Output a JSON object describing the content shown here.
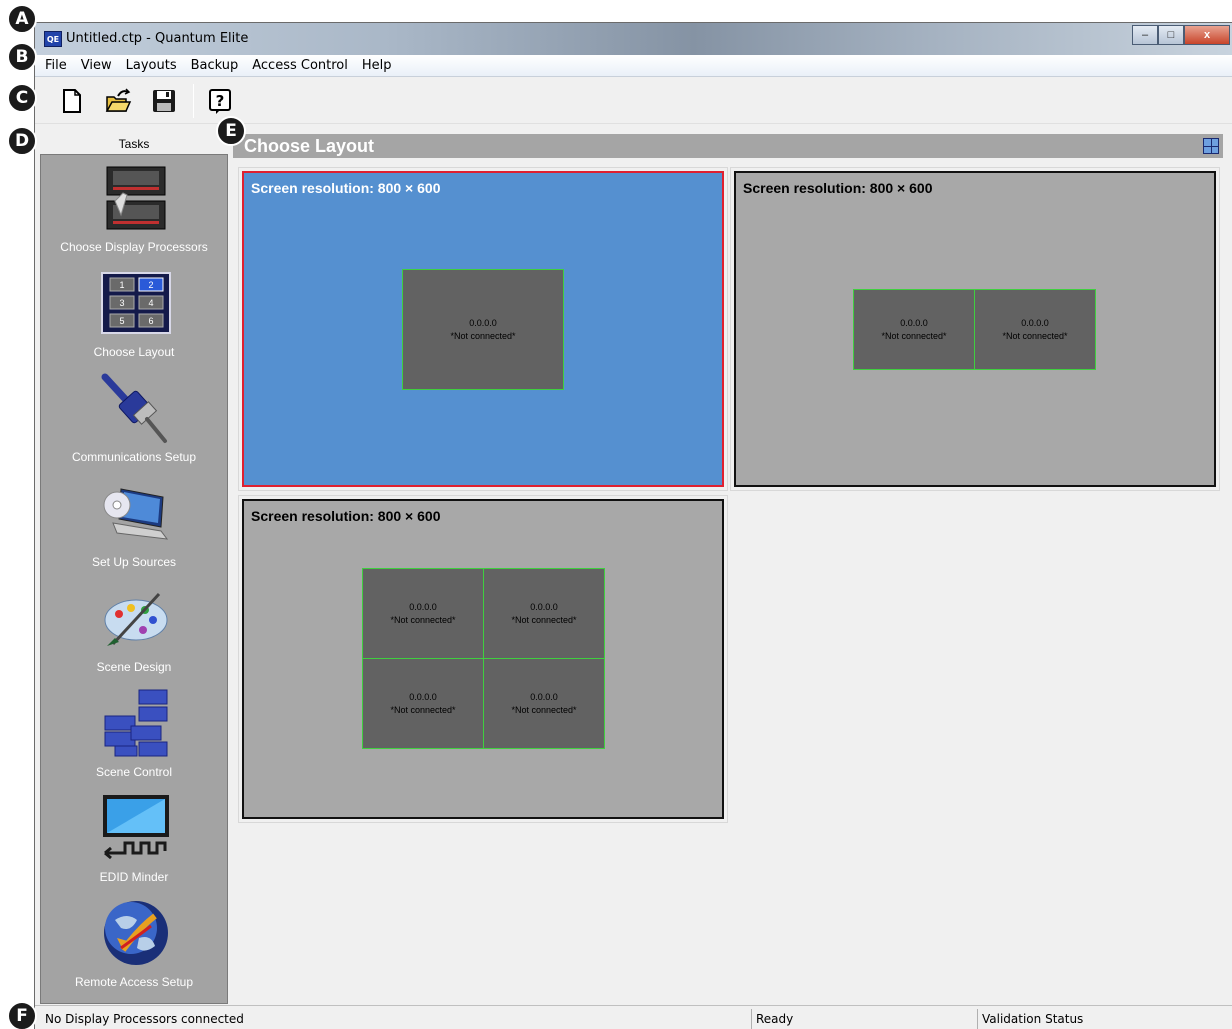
{
  "markers": [
    "A",
    "B",
    "C",
    "D",
    "E",
    "F"
  ],
  "window": {
    "app_icon_text": "QE",
    "title": "Untitled.ctp - Quantum Elite",
    "controls": {
      "minimize": "–",
      "maximize": "□",
      "close": "x"
    }
  },
  "menu": [
    "File",
    "View",
    "Layouts",
    "Backup",
    "Access Control",
    "Help"
  ],
  "toolbar": {
    "buttons": [
      {
        "name": "new",
        "icon": "new-document-icon"
      },
      {
        "name": "open",
        "icon": "open-folder-icon"
      },
      {
        "name": "save",
        "icon": "save-disk-icon"
      },
      {
        "name": "help",
        "icon": "help-question-icon"
      }
    ]
  },
  "tasks": {
    "header": "Tasks",
    "items": [
      {
        "label": "Choose Display Processors",
        "icon": "display-processors-icon"
      },
      {
        "label": "Choose Layout",
        "icon": "layout-grid-icon"
      },
      {
        "label": "Communications Setup",
        "icon": "cable-connector-icon"
      },
      {
        "label": "Set Up Sources",
        "icon": "laptop-disc-icon"
      },
      {
        "label": "Scene Design",
        "icon": "paint-palette-icon"
      },
      {
        "label": "Scene Control",
        "icon": "scene-blocks-icon"
      },
      {
        "label": "EDID Minder",
        "icon": "edid-monitor-icon"
      },
      {
        "label": "Remote Access Setup",
        "icon": "globe-arrow-icon"
      }
    ],
    "layout_icon_numbers": [
      "1",
      "2",
      "3",
      "4",
      "5",
      "6"
    ]
  },
  "main": {
    "title": "Choose Layout",
    "layouts": [
      {
        "resolution": "Screen resolution: 800 × 600",
        "selected": true,
        "screens": [
          {
            "ip": "0.0.0.0",
            "status": "*Not connected*"
          }
        ]
      },
      {
        "resolution": "Screen resolution: 800 × 600",
        "selected": false,
        "screens": [
          {
            "ip": "0.0.0.0",
            "status": "*Not connected*"
          },
          {
            "ip": "0.0.0.0",
            "status": "*Not connected*"
          }
        ]
      },
      {
        "resolution": "Screen resolution: 800 × 600",
        "selected": false,
        "screens": [
          {
            "ip": "0.0.0.0",
            "status": "*Not connected*"
          },
          {
            "ip": "0.0.0.0",
            "status": "*Not connected*"
          },
          {
            "ip": "0.0.0.0",
            "status": "*Not connected*"
          },
          {
            "ip": "0.0.0.0",
            "status": "*Not connected*"
          }
        ]
      }
    ]
  },
  "status": {
    "left": "No Display Processors connected",
    "middle": "Ready",
    "right": "Validation Status"
  },
  "colors": {
    "selected_layout_bg": "#5590d0",
    "selected_layout_border": "#e02030",
    "screen_border": "#3fcf3f",
    "tasks_panel_bg": "#a3a3a3"
  }
}
